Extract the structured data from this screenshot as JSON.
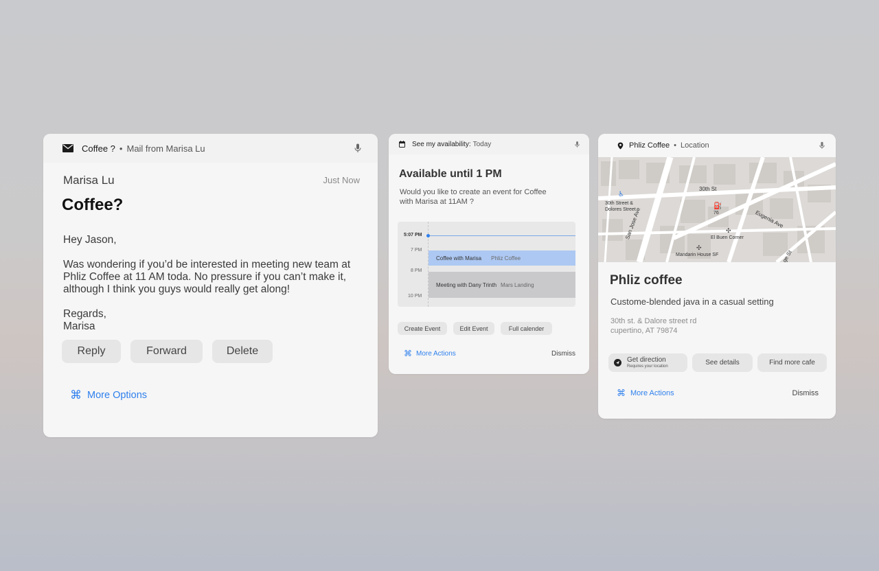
{
  "mail_card": {
    "header": {
      "icon": "mail-icon",
      "title": "Coffee ?",
      "separator": "•",
      "subtitle": "Mail from Marisa Lu",
      "mic_icon": "microphone-icon"
    },
    "sender": "Marisa Lu",
    "timestamp": "Just Now",
    "subject": "Coffee?",
    "greeting": "Hey Jason,",
    "body": "Was wondering if you’d  be interested in meeting new team at Phliz Coffee at 11 AM toda. No pressure if you can’t make it, although I think you guys would really get along!",
    "signoff_line1": "Regards,",
    "signoff_line2": "Marisa",
    "actions": {
      "reply": "Reply",
      "forward": "Forward",
      "delete": "Delete"
    },
    "more_options": "More Options",
    "more_icon": "command-icon"
  },
  "calendar_card": {
    "header": {
      "icon": "calendar-icon",
      "title": "See my availability:",
      "subtitle": "Today",
      "mic_icon": "microphone-icon"
    },
    "headline": "Available until 1 PM",
    "question": "Would you like to create an event for Coffee with Marisa at 11AM ?",
    "timeline": {
      "now_label": "5:07 PM",
      "labels": [
        "7 PM",
        "8 PM",
        "10 PM"
      ],
      "events": [
        {
          "title": "Coffee with Marisa",
          "location": "Phliz Coffee"
        },
        {
          "title": "Meeting with Dany Trinth",
          "location": "Mars Landing"
        }
      ]
    },
    "actions": {
      "create": "Create Event",
      "edit": "Edit Event",
      "full": "Full calender"
    },
    "more_actions": "More Actions",
    "dismiss": "Dismiss",
    "accent": "#2f80ed"
  },
  "location_card": {
    "header": {
      "icon": "location-pin-icon",
      "title": "Phliz Coffee",
      "separator": "•",
      "subtitle": "Location",
      "mic_icon": "microphone-icon"
    },
    "map": {
      "streets": [
        "30th St",
        "Eugenia Ave",
        "San Jose Ave",
        "ge St"
      ],
      "places": [
        "30th Street & Dolores Street",
        "76",
        "El Buen Corner",
        "Mandarin House SF"
      ]
    },
    "name": "Phliz coffee",
    "description": "Custome-blended java in a casual setting",
    "address_line1": "30th st. & Dalore street rd",
    "address_line2": "cupertino, AT 79874",
    "actions": {
      "direction": "Get direction",
      "direction_sub": "Requires your location",
      "details": "See details",
      "find_more": "Find more cafe"
    },
    "more_actions": "More Actions",
    "dismiss": "Dismiss"
  }
}
